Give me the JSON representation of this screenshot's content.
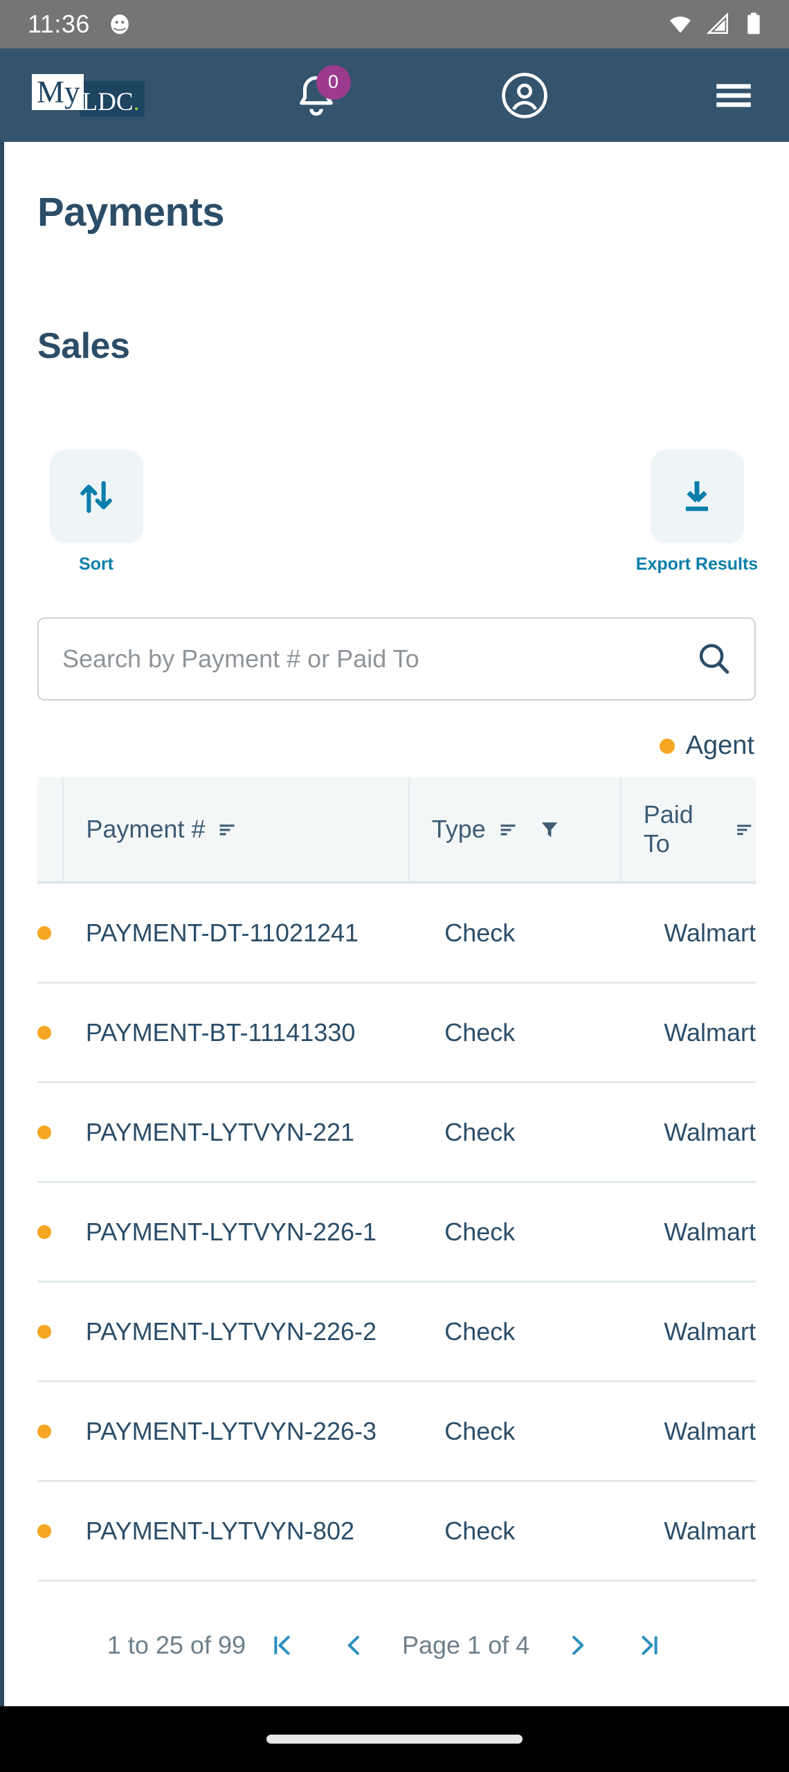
{
  "status_bar": {
    "time": "11:36",
    "icons": [
      "android-head-icon",
      "wifi-icon",
      "cell-signal-icon",
      "battery-icon"
    ]
  },
  "app_bar": {
    "logo_my": "My",
    "logo_ldc": "LDC",
    "logo_dot": ".",
    "notification_count": "0",
    "icons": [
      "bell-icon",
      "account-circle-icon",
      "hamburger-menu-icon"
    ],
    "background_color": "#34546d"
  },
  "page": {
    "title": "Payments",
    "section_title": "Sales"
  },
  "actions": [
    {
      "name": "sort",
      "label": "Sort",
      "icon": "sort-arrows-icon"
    },
    {
      "name": "export",
      "label": "Export Results",
      "icon": "download-icon"
    }
  ],
  "search": {
    "placeholder": "Search by Payment # or Paid To",
    "value": "",
    "icon": "search-icon"
  },
  "legend": [
    {
      "label": "Agent",
      "color": "#f5a623"
    }
  ],
  "table": {
    "columns": [
      {
        "key": "payment",
        "label": "Payment #",
        "sortable": true,
        "filterable": false
      },
      {
        "key": "type",
        "label": "Type",
        "sortable": true,
        "filterable": true
      },
      {
        "key": "paid_to",
        "label": "Paid To",
        "sortable": true,
        "filterable": false
      }
    ],
    "rows": [
      {
        "status_color": "#f5a623",
        "payment": "PAYMENT-DT-11021241",
        "type": "Check",
        "paid_to": "Walmart"
      },
      {
        "status_color": "#f5a623",
        "payment": "PAYMENT-BT-11141330",
        "type": "Check",
        "paid_to": "Walmart"
      },
      {
        "status_color": "#f5a623",
        "payment": "PAYMENT-LYTVYN-221",
        "type": "Check",
        "paid_to": "Walmart"
      },
      {
        "status_color": "#f5a623",
        "payment": "PAYMENT-LYTVYN-226-1",
        "type": "Check",
        "paid_to": "Walmart"
      },
      {
        "status_color": "#f5a623",
        "payment": "PAYMENT-LYTVYN-226-2",
        "type": "Check",
        "paid_to": "Walmart"
      },
      {
        "status_color": "#f5a623",
        "payment": "PAYMENT-LYTVYN-226-3",
        "type": "Check",
        "paid_to": "Walmart"
      },
      {
        "status_color": "#f5a623",
        "payment": "PAYMENT-LYTVYN-802",
        "type": "Check",
        "paid_to": "Walmart"
      }
    ]
  },
  "pagination": {
    "summary": "1 to 25 of 99",
    "page_label": "Page 1 of 4",
    "first_icon": "first-page-icon",
    "prev_icon": "previous-page-icon",
    "next_icon": "next-page-icon",
    "last_icon": "last-page-icon"
  },
  "colors": {
    "header": "#34546d",
    "primary_text": "#2b4d68",
    "link": "#0b7fab",
    "accent_agent": "#f5a623",
    "badge": "#9c3a8d",
    "logo_green": "#8dc63f"
  }
}
